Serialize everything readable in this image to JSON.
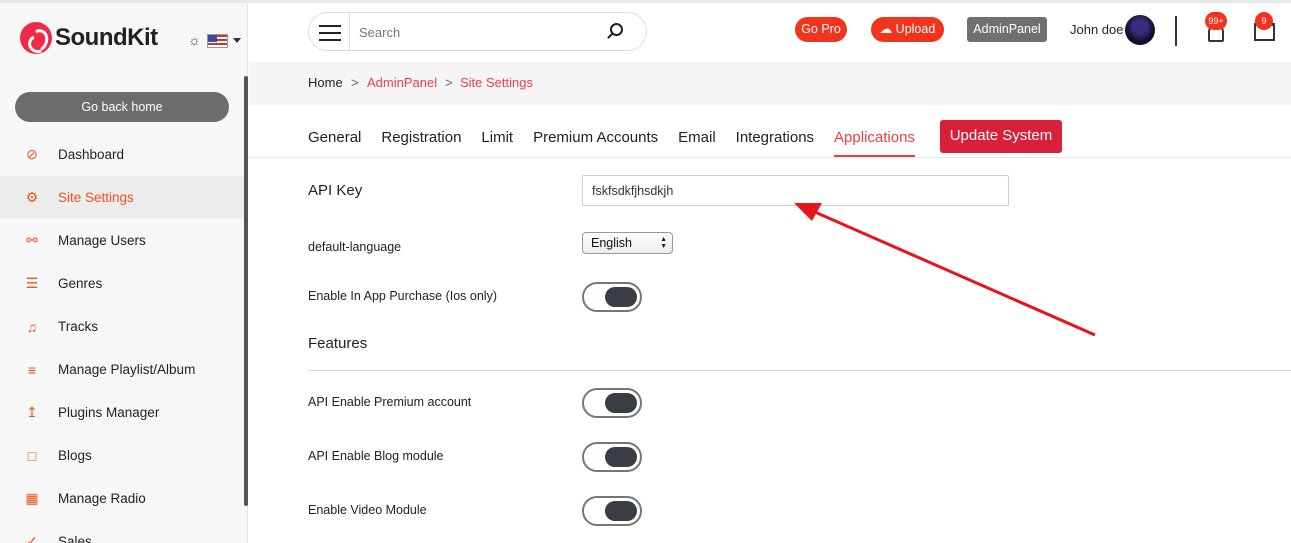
{
  "app": {
    "name": "SoundKit"
  },
  "header": {
    "search_placeholder": "Search",
    "go_pro": "Go Pro",
    "upload": "Upload",
    "admin_panel": "AdminPanel",
    "username": "John doe",
    "notifications_count": "99+",
    "cart_count": "9"
  },
  "sidebar": {
    "go_back": "Go back home",
    "items": [
      {
        "label": "Dashboard",
        "icon": "dashboard-icon"
      },
      {
        "label": "Site Settings",
        "icon": "gear-icon"
      },
      {
        "label": "Manage Users",
        "icon": "users-icon"
      },
      {
        "label": "Genres",
        "icon": "list-icon"
      },
      {
        "label": "Tracks",
        "icon": "music-note-icon"
      },
      {
        "label": "Manage Playlist/Album",
        "icon": "playlist-icon"
      },
      {
        "label": "Plugins Manager",
        "icon": "upload-icon"
      },
      {
        "label": "Blogs",
        "icon": "note-icon"
      },
      {
        "label": "Manage Radio",
        "icon": "film-icon"
      },
      {
        "label": "Sales",
        "icon": "cart-icon"
      }
    ],
    "active_index": 1
  },
  "breadcrumb": {
    "home": "Home",
    "sep": ">",
    "admin": "AdminPanel",
    "current": "Site Settings"
  },
  "tabs": {
    "items": [
      "General",
      "Registration",
      "Limit",
      "Premium Accounts",
      "Email",
      "Integrations",
      "Applications"
    ],
    "active": "Applications",
    "update_button": "Update System"
  },
  "form": {
    "api_key_label": "API Key",
    "api_key_value": "fskfsdkfjhsdkjh",
    "default_language_label": "default-language",
    "default_language_value": "English",
    "in_app_purchase_label": "Enable In App Purchase (Ios only)",
    "in_app_purchase_on": true,
    "features_heading": "Features",
    "features": [
      {
        "label": "API Enable Premium account",
        "on": true
      },
      {
        "label": "API Enable Blog module",
        "on": true
      },
      {
        "label": "Enable Video Module",
        "on": true
      }
    ]
  },
  "colors": {
    "accent": "#f4501e",
    "brand": "#ef2a49",
    "button_red": "#d9203a",
    "annotation": "#e8141b"
  }
}
